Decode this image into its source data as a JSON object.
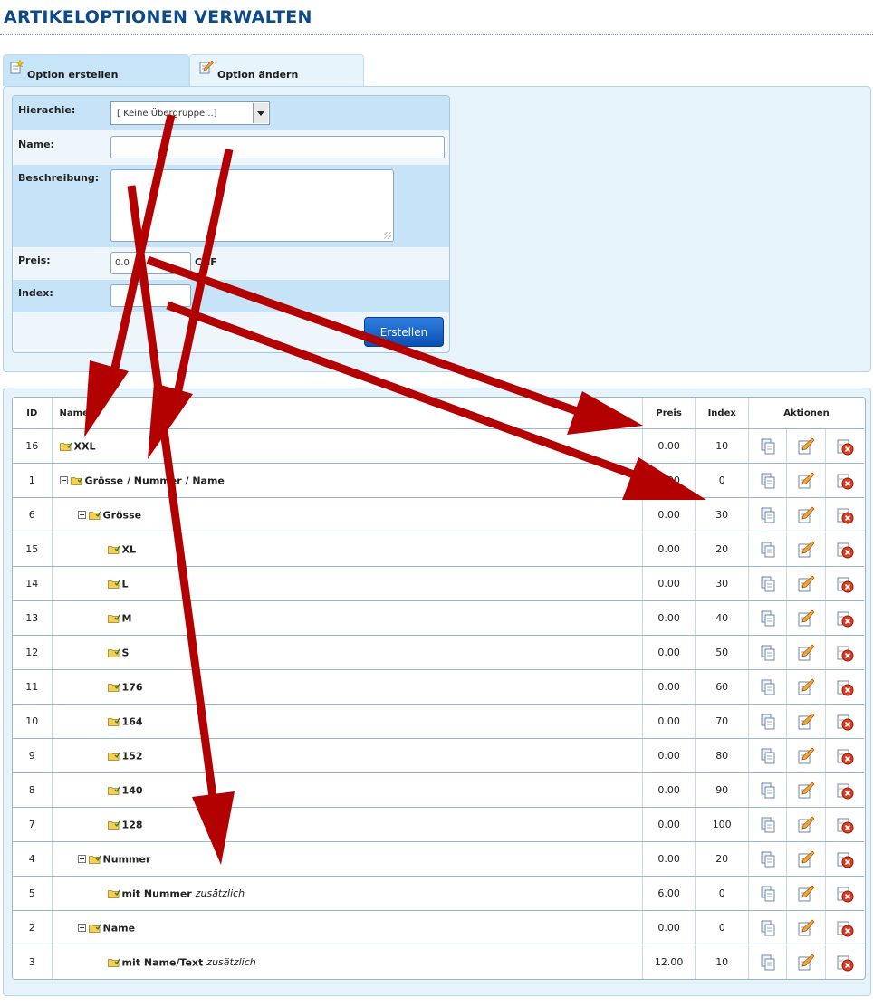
{
  "page": {
    "title": "ARTIKELOPTIONEN VERWALTEN"
  },
  "tabs": [
    {
      "label": "Option erstellen",
      "icon": "add-option-icon"
    },
    {
      "label": "Option ändern",
      "icon": "edit-option-icon"
    }
  ],
  "form": {
    "hierarchy": {
      "label": "Hierachie:",
      "value": "[ Keine Übergruppe...]"
    },
    "name": {
      "label": "Name:",
      "value": ""
    },
    "description": {
      "label": "Beschreibung:",
      "value": ""
    },
    "price": {
      "label": "Preis:",
      "value": "0.0",
      "unit": "CHF"
    },
    "index": {
      "label": "Index:",
      "value": ""
    },
    "submit_label": "Erstellen"
  },
  "table": {
    "headers": {
      "id": "ID",
      "name": "Name",
      "price": "Preis",
      "index": "Index",
      "actions": "Aktionen"
    },
    "rows": [
      {
        "id": "16",
        "name": "XXL",
        "extra": "",
        "level": 0,
        "toggle": false,
        "price": "0.00",
        "index": "10"
      },
      {
        "id": "1",
        "name": "Grösse / Nummer / Name",
        "extra": "",
        "level": 0,
        "toggle": true,
        "price": "0.00",
        "index": "0"
      },
      {
        "id": "6",
        "name": "Grösse",
        "extra": "",
        "level": 1,
        "toggle": true,
        "price": "0.00",
        "index": "30"
      },
      {
        "id": "15",
        "name": "XL",
        "extra": "",
        "level": 2,
        "toggle": false,
        "price": "0.00",
        "index": "20"
      },
      {
        "id": "14",
        "name": "L",
        "extra": "",
        "level": 2,
        "toggle": false,
        "price": "0.00",
        "index": "30"
      },
      {
        "id": "13",
        "name": "M",
        "extra": "",
        "level": 2,
        "toggle": false,
        "price": "0.00",
        "index": "40"
      },
      {
        "id": "12",
        "name": "S",
        "extra": "",
        "level": 2,
        "toggle": false,
        "price": "0.00",
        "index": "50"
      },
      {
        "id": "11",
        "name": "176",
        "extra": "",
        "level": 2,
        "toggle": false,
        "price": "0.00",
        "index": "60"
      },
      {
        "id": "10",
        "name": "164",
        "extra": "",
        "level": 2,
        "toggle": false,
        "price": "0.00",
        "index": "70"
      },
      {
        "id": "9",
        "name": "152",
        "extra": "",
        "level": 2,
        "toggle": false,
        "price": "0.00",
        "index": "80"
      },
      {
        "id": "8",
        "name": "140",
        "extra": "",
        "level": 2,
        "toggle": false,
        "price": "0.00",
        "index": "90"
      },
      {
        "id": "7",
        "name": "128",
        "extra": "",
        "level": 2,
        "toggle": false,
        "price": "0.00",
        "index": "100"
      },
      {
        "id": "4",
        "name": "Nummer",
        "extra": "",
        "level": 1,
        "toggle": true,
        "price": "0.00",
        "index": "20"
      },
      {
        "id": "5",
        "name": "mit Nummer",
        "extra": "zusätzlich",
        "level": 2,
        "toggle": false,
        "price": "6.00",
        "index": "0"
      },
      {
        "id": "2",
        "name": "Name",
        "extra": "",
        "level": 1,
        "toggle": true,
        "price": "0.00",
        "index": "0"
      },
      {
        "id": "3",
        "name": "mit Name/Text",
        "extra": "zusätzlich",
        "level": 2,
        "toggle": false,
        "price": "12.00",
        "index": "10"
      }
    ],
    "action_icons": [
      "copy-icon",
      "edit-icon",
      "delete-icon"
    ]
  },
  "colors": {
    "title": "#0d4a8c",
    "panel_bg": "#e6f3fb",
    "row_shade": "#c7e3f8",
    "button": "#1466d0",
    "annotation_arrow": "#b30000"
  }
}
